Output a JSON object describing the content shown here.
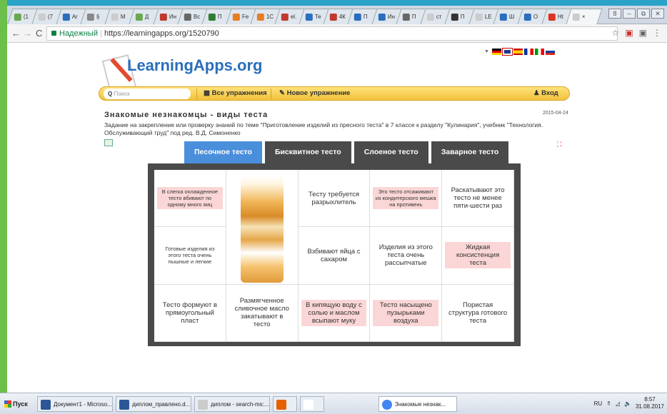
{
  "browser": {
    "tabs": [
      {
        "label": "(1",
        "color": "#6aa84f"
      },
      {
        "label": "(7",
        "color": "#ccc"
      },
      {
        "label": "Ar",
        "color": "#2a6ebd"
      },
      {
        "label": "§",
        "color": "#888"
      },
      {
        "label": "M",
        "color": "#ccc"
      },
      {
        "label": "Д",
        "color": "#6aa84f"
      },
      {
        "label": "Ин",
        "color": "#c0392b"
      },
      {
        "label": "Вс",
        "color": "#666"
      },
      {
        "label": "П",
        "color": "#2e7d32"
      },
      {
        "label": "Fe",
        "color": "#e67e22"
      },
      {
        "label": "1С",
        "color": "#e67e22"
      },
      {
        "label": "el.",
        "color": "#c0392b"
      },
      {
        "label": "Те",
        "color": "#2a6ebd"
      },
      {
        "label": "4К",
        "color": "#c0392b"
      },
      {
        "label": "П",
        "color": "#2a6ebd"
      },
      {
        "label": "Ин",
        "color": "#2a6ebd"
      },
      {
        "label": "П",
        "color": "#666"
      },
      {
        "label": "ст",
        "color": "#ccc"
      },
      {
        "label": "П",
        "color": "#333"
      },
      {
        "label": "LE",
        "color": "#ccc"
      },
      {
        "label": "Ш",
        "color": "#2a6ebd"
      },
      {
        "label": "О",
        "color": "#2a6ebd"
      },
      {
        "label": "Ht",
        "color": "#d32"
      },
      {
        "label": "×",
        "color": "#ccc",
        "active": true
      }
    ],
    "secure_label": "Надежный",
    "url": "https://learningapps.org/1520790",
    "window_controls": [
      "8",
      "–",
      "⧉",
      "✕"
    ]
  },
  "site": {
    "logo_text": "LearningApps.org",
    "search_placeholder": "Поиск",
    "nav": {
      "all_exercises": "Все упражнения",
      "new_exercise": "Новое упражнение",
      "login": "Вход"
    }
  },
  "exercise": {
    "title": "Знакомые незнакомцы - виды теста",
    "date": "2015-04-24",
    "description": "Задание на закрепление или проверку знаний по теме \"Приготовление изделий из пресного теста\" в 7 классе к разделу \"Кулинария\", учебник \"Технология. Обслуживающий труд\" под ред. В.Д. Симоненко",
    "tabs": [
      "Песочное тесто",
      "Бисквитное тесто",
      "Слоеное тесто",
      "Заварное тесто"
    ],
    "cells": [
      {
        "text": "В слегка охлажденное тесто вбивают по одному много яиц",
        "small": true,
        "pink": true
      },
      {
        "text": "Тесту требуется разрыхлитель",
        "small": false,
        "pink": false
      },
      {
        "text": "Это тесто отсаживают из кондитерского мешка на противень",
        "small": true,
        "pink": true
      },
      {
        "text": "Раскатывают это тесто не менее пяти-шести раз",
        "small": false,
        "pink": false
      },
      {
        "text": "Готовые изделия из этого теста очень пышные и легкие",
        "small": true,
        "pink": false
      },
      {
        "text": "Взбивают яйца с сахаром",
        "small": false,
        "pink": false
      },
      {
        "text": "Изделия из этого теста очень рассыпчатые",
        "small": false,
        "pink": false
      },
      {
        "text": "Жидкая консистенция теста",
        "small": false,
        "pink": true
      },
      {
        "text": "Тесто формуют в прямоугольный пласт",
        "small": false,
        "pink": false
      },
      {
        "text": "Размягченное сливочное масло закатывают в тесто",
        "small": false,
        "pink": false
      },
      {
        "text": "В кипящую воду с солью и маслом всыпают муку",
        "small": false,
        "pink": true
      },
      {
        "text": "Тесто насыщено пузырьками воздуха",
        "small": false,
        "pink": true
      },
      {
        "text": "Пористая структура готового теста",
        "small": false,
        "pink": false
      }
    ]
  },
  "taskbar": {
    "start": "Пуск",
    "items": [
      {
        "label": "Документ1 - Microso...",
        "color": "#2b5797"
      },
      {
        "label": "диплом_правлено.d...",
        "color": "#2b5797"
      },
      {
        "label": "диплом - search-ms:...",
        "color": "#ccc"
      },
      {
        "label": "",
        "color": "#e66000"
      },
      {
        "label": "",
        "color": "#fff"
      },
      {
        "label": "Знакомые незнак...",
        "color": "#4285f4",
        "active": true
      }
    ],
    "lang": "RU",
    "time": "8:57",
    "date": "31.08.2017"
  }
}
